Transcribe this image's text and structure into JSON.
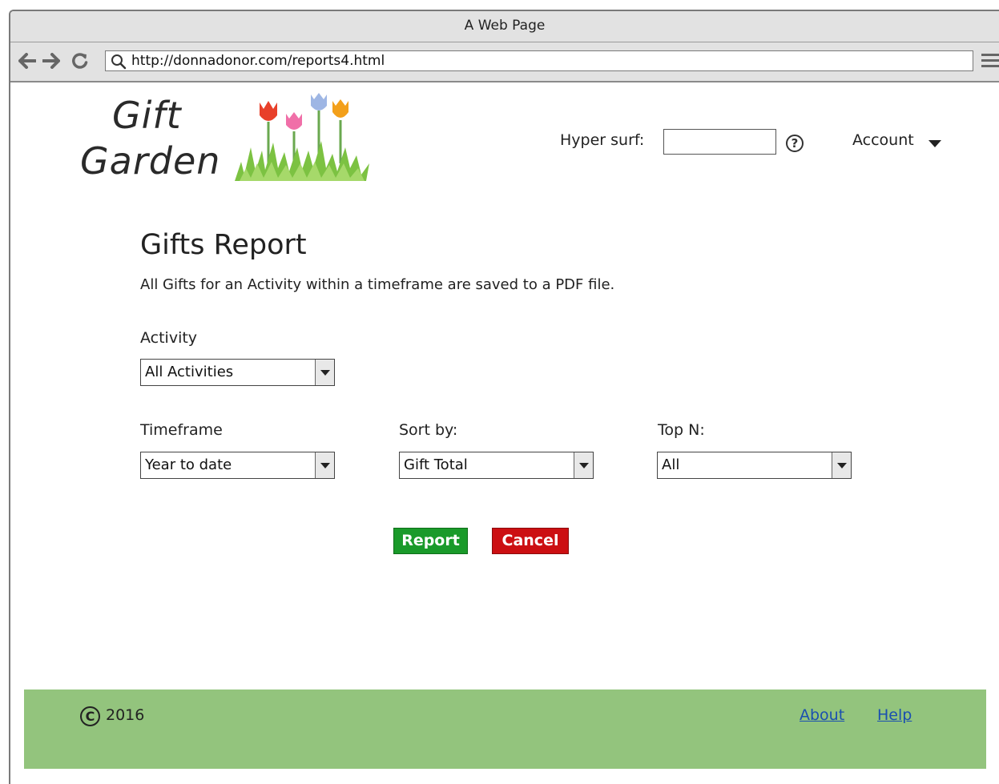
{
  "browser": {
    "title": "A Web Page",
    "url": "http://donnadonor.com/reports4.html"
  },
  "header": {
    "logo_line1": "Gift",
    "logo_line2": "Garden",
    "hyper_surf_label": "Hyper surf:",
    "hyper_surf_value": "",
    "help_glyph": "?",
    "account_label": "Account"
  },
  "report": {
    "title": "Gifts Report",
    "description": "All Gifts for an Activity within a timeframe are saved to a PDF file.",
    "activity": {
      "label": "Activity",
      "value": "All Activities"
    },
    "timeframe": {
      "label": "Timeframe",
      "value": "Year to date"
    },
    "sort_by": {
      "label": "Sort by:",
      "value": "Gift Total"
    },
    "top_n": {
      "label": "Top N:",
      "value": "All"
    },
    "report_button": "Report",
    "cancel_button": "Cancel"
  },
  "footer": {
    "copyright_glyph": "C",
    "year": "2016",
    "about_link": "About",
    "help_link": "Help"
  },
  "colors": {
    "report_button": "#1a9a2a",
    "cancel_button": "#cc0f12",
    "footer_bg": "#93c47d",
    "link": "#1a4fb0"
  },
  "icons": {
    "back": "back-arrow-icon",
    "forward": "forward-arrow-icon",
    "reload": "reload-icon",
    "search": "search-icon",
    "menu": "hamburger-menu-icon",
    "help": "help-icon",
    "dropdown": "caret-down-icon",
    "copyright": "copyright-icon",
    "logo": "tulips-icon"
  }
}
